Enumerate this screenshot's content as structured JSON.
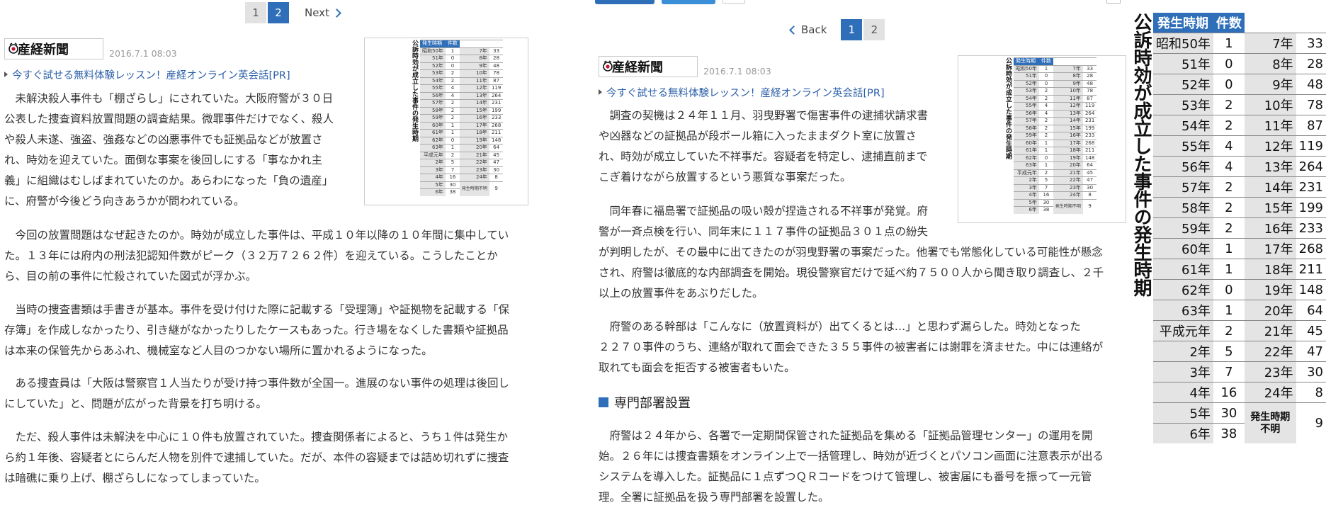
{
  "left": {
    "pager": {
      "pages": [
        "1",
        "2"
      ],
      "current": "2",
      "next": "Next"
    },
    "logo": "産経新聞",
    "date": "2016.7.1 08:03",
    "pr": "今すぐ試せる無料体験レッスン！産経オンライン英会話[PR]",
    "paragraphs": [
      [
        "　未解決殺人事件も「棚ざらし」にされていた。大阪府警が３０日",
        "公表した捜査資料放置問題の調査結果。微罪事件だけでなく、殺人",
        "や殺人未遂、強盗、強姦などの凶悪事件でも証拠品などが放置さ",
        "れ、時効を迎えていた。面倒な事案を後回しにする「事なかれ主",
        "義」に組織はむしばまれていたのか。あらわになった「負の遺産」",
        "に、府警が今後どう向きあうかが問われている。"
      ],
      [
        "　今回の放置問題はなぜ起きたのか。時効が成立した事件は、平成１０年以降の１０年間に集中してい",
        "た。１３年には府内の刑法犯認知件数がピーク（３２万７２６２件）を迎えている。こうしたことか",
        "ら、目の前の事件に忙殺されていた図式が浮かぶ。"
      ],
      [
        "　当時の捜査書類は手書きが基本。事件を受け付けた際に記載する「受理簿」や証拠物を記載する「保",
        "存簿」を作成しなかったり、引き継がなかったりしたケースもあった。行き場をなくした書類や証拠品",
        "は本来の保管先からあふれ、機械室など人目のつかない場所に置かれるようになった。"
      ],
      [
        "　ある捜査員は「大阪は警察官１人当たりが受け持つ事件数が全国一。進展のない事件の処理は後回し",
        "にしていた」と、問題が広がった背景を打ち明ける。"
      ],
      [
        "　ただ、殺人事件は未解決を中心に１０件も放置されていた。捜査関係者によると、うち１件は発生か",
        "ら約１年後、容疑者とにらんだ人物を別件で逮捕していた。だが、本件の容疑までは詰め切れずに捜査",
        "は暗礁に乗り上げ、棚ざらしになってしまっていた。"
      ]
    ]
  },
  "middle": {
    "pager": {
      "back": "Back",
      "pages": [
        "1",
        "2"
      ],
      "current": "1"
    },
    "logo": "産経新聞",
    "date": "2016.7.1 08:03",
    "pr": "今すぐ試せる無料体験レッスン！産経オンライン英会話[PR]",
    "paragraphs": [
      [
        "　調査の契機は２４年１１月、羽曳野署で傷害事件の逮捕状請求書",
        "や凶器などの証拠品が段ボール箱に入ったままダクト室に放置さ",
        "れ、時効が成立していた不祥事だ。容疑者を特定し、逮捕直前まで",
        "こぎ着けながら放置するという悪質な事案だった。"
      ],
      [
        "　同年春に福島署で証拠品の吸い殻が捏造される不祥事が発覚。府",
        "警が一斉点検を行い、同年末に１１７事件の証拠品３０１点の紛失",
        "が判明したが、その最中に出てきたのが羽曳野署の事案だった。他署でも常態化している可能性が懸念",
        "され、府警は徹底的な内部調査を開始。現役警察官だけで延べ約７５００人から聞き取り調査し、２千",
        "以上の放置事件をあぶりだした。"
      ],
      [
        "　府警のある幹部は「こんなに（放置資料が）出てくるとは…」と思わず漏らした。時効となった",
        "２２７０事件のうち、連絡が取れて面会できた３５５事件の被害者には謝罪を済ませた。中には連絡が",
        "取れても面会を拒否する被害者もいた。"
      ],
      [
        "　府警は２４年から、各署で一定期間保管された証拠品を集める「証拠品管理センター」の運用を開",
        "始。２６年には捜査書類をオンライン上で一括管理し、時効が近づくとパソコン画面に注意表示が出る",
        "システムを導入した。証拠品に１点ずつＱＲコードをつけて管理し、被害届にも番号を振って一元管",
        "理。全署に証拠品を扱う専門部署を設置した。"
      ]
    ],
    "heading": "専門部署設置"
  },
  "table": {
    "title": "公訴時効が成立した事件の発生時期",
    "headers": [
      "発生時期",
      "件数"
    ],
    "left_col": [
      [
        "昭和50年",
        "1"
      ],
      [
        "51年",
        "0"
      ],
      [
        "52年",
        "0"
      ],
      [
        "53年",
        "2"
      ],
      [
        "54年",
        "2"
      ],
      [
        "55年",
        "4"
      ],
      [
        "56年",
        "4"
      ],
      [
        "57年",
        "2"
      ],
      [
        "58年",
        "2"
      ],
      [
        "59年",
        "2"
      ],
      [
        "60年",
        "1"
      ],
      [
        "61年",
        "1"
      ],
      [
        "62年",
        "0"
      ],
      [
        "63年",
        "1"
      ],
      [
        "平成元年",
        "2"
      ],
      [
        "2年",
        "5"
      ],
      [
        "3年",
        "7"
      ],
      [
        "4年",
        "16"
      ],
      [
        "5年",
        "30"
      ],
      [
        "6年",
        "38"
      ]
    ],
    "right_col": [
      [
        "7年",
        "33"
      ],
      [
        "8年",
        "28"
      ],
      [
        "9年",
        "48"
      ],
      [
        "10年",
        "78"
      ],
      [
        "11年",
        "87"
      ],
      [
        "12年",
        "119"
      ],
      [
        "13年",
        "264"
      ],
      [
        "14年",
        "231"
      ],
      [
        "15年",
        "199"
      ],
      [
        "16年",
        "233"
      ],
      [
        "17年",
        "268"
      ],
      [
        "18年",
        "211"
      ],
      [
        "19年",
        "148"
      ],
      [
        "20年",
        "64"
      ],
      [
        "21年",
        "45"
      ],
      [
        "22年",
        "47"
      ],
      [
        "23年",
        "30"
      ],
      [
        "24年",
        "8"
      ]
    ],
    "unknown": {
      "label": "発生時期不明",
      "label_line1": "発生時期",
      "label_line2": "不明",
      "value": "9"
    }
  }
}
